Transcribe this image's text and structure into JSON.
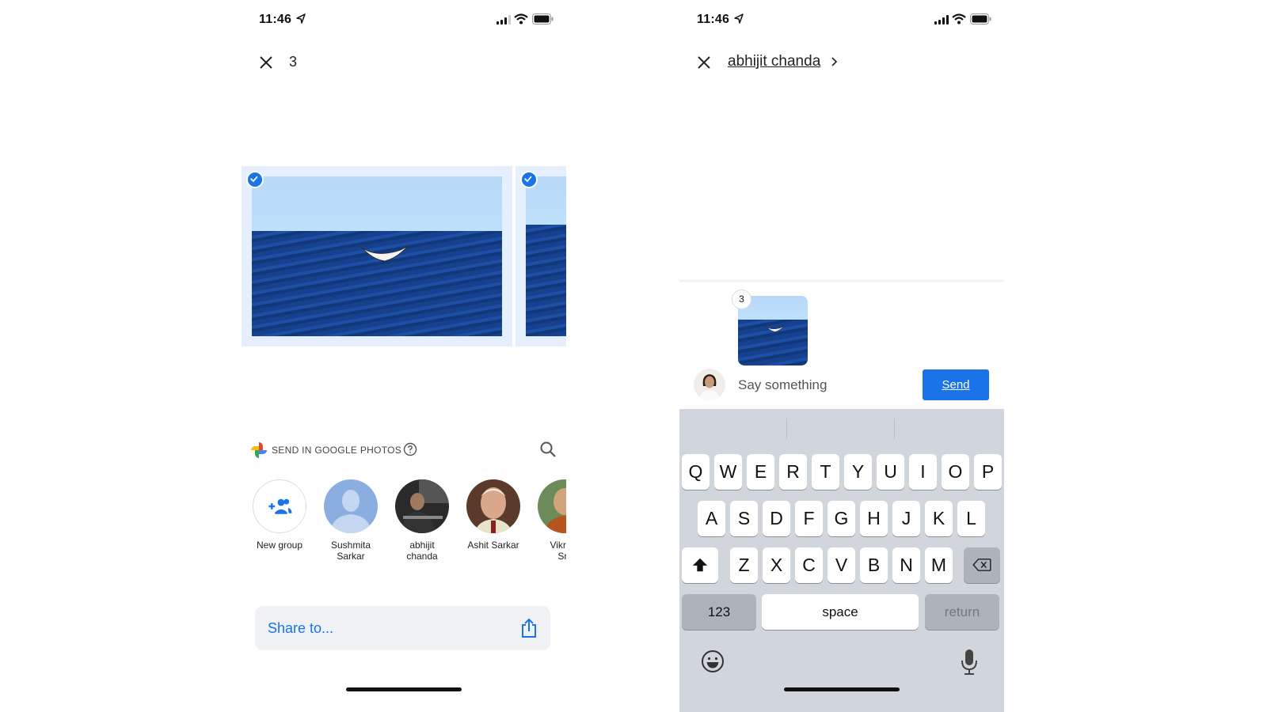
{
  "left_screen": {
    "status": {
      "time": "11:46"
    },
    "header": {
      "selected_count": "3"
    },
    "photos": [
      {
        "description": "Whale tail in ocean",
        "selected": true
      },
      {
        "description": "Ocean photo",
        "selected": true
      }
    ],
    "send_section": {
      "label": "SEND IN GOOGLE PHOTOS",
      "icons": {
        "logo": "google-photos-pinwheel",
        "help": "help-circle-icon",
        "search": "search-icon"
      }
    },
    "contacts": [
      {
        "name": "New group",
        "type": "new-group"
      },
      {
        "name": "Sushmita Sarkar",
        "type": "placeholder"
      },
      {
        "name": "abhijit chanda",
        "type": "photo"
      },
      {
        "name": "Ashit Sarkar",
        "type": "photo"
      },
      {
        "name": "Vikram Srii",
        "type": "photo",
        "partially_visible": true,
        "visible_text": "Vikı Srii"
      }
    ],
    "share_to": {
      "label": "Share to...",
      "icon": "share-icon"
    }
  },
  "right_screen": {
    "status": {
      "time": "11:46"
    },
    "header": {
      "recipient": "abhijit chanda"
    },
    "attachment": {
      "count_badge": "3"
    },
    "composer": {
      "placeholder": "Say something",
      "value": "",
      "send_label": "Send"
    },
    "keyboard": {
      "row1": [
        "Q",
        "W",
        "E",
        "R",
        "T",
        "Y",
        "U",
        "I",
        "O",
        "P"
      ],
      "row2": [
        "A",
        "S",
        "D",
        "F",
        "G",
        "H",
        "J",
        "K",
        "L"
      ],
      "row3": [
        "Z",
        "X",
        "C",
        "V",
        "B",
        "N",
        "M"
      ],
      "numbers_label": "123",
      "space_label": "space",
      "return_label": "return"
    }
  },
  "colors": {
    "accent": "#1a73e8",
    "selection_bg": "#e6effd",
    "keyboard_bg": "#d1d5dc"
  }
}
